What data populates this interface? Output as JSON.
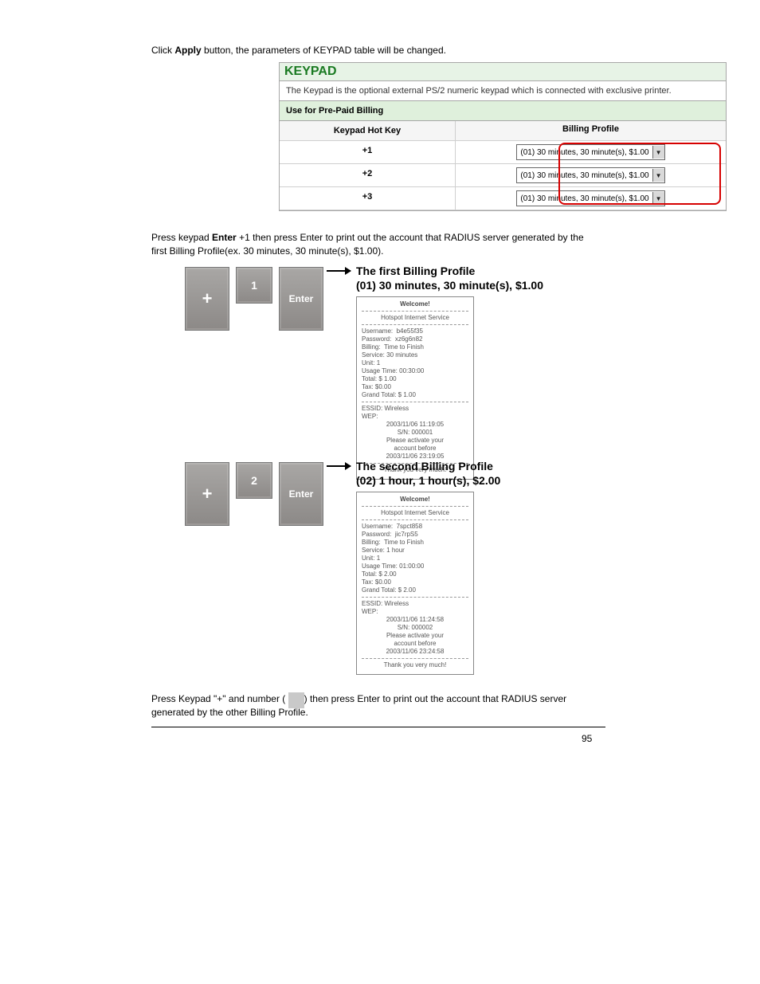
{
  "intro": {
    "prefix": "Click ",
    "apply": "Apply",
    "suffix": " button, the parameters of KEYPAD table will be changed."
  },
  "keypad_panel": {
    "title": "KEYPAD",
    "desc": "The Keypad is the optional external PS/2 numeric keypad which is connected with exclusive printer.",
    "section": "Use for Pre-Paid Billing",
    "col_hotkey": "Keypad Hot Key",
    "col_profile": "Billing Profile",
    "rows": [
      {
        "hotkey": "+1",
        "profile": "(01) 30 minutes, 30 minute(s), $1.00"
      },
      {
        "hotkey": "+2",
        "profile": "(01) 30 minutes, 30 minute(s), $1.00"
      },
      {
        "hotkey": "+3",
        "profile": "(01) 30 minutes, 30 minute(s), $1.00"
      }
    ]
  },
  "example": {
    "prefix": "Press keypad ",
    "plus": "+",
    "one": "1",
    "two": "2",
    "enter_word": "Enter",
    "suffix_1": " +1 then press Enter to print out the account that RADIUS server generated by the first Billing Profile(ex. 30 minutes, 30 minute(s), $1.00)."
  },
  "profile1": {
    "title_line1": "The first Billing Profile",
    "title_line2": "(01) 30 minutes, 30 minute(s), $1.00"
  },
  "profile2": {
    "title_line1": "The second Billing Profile",
    "title_line2": "(02) 1 hour, 1 hour(s), $2.00"
  },
  "receipt1": {
    "welcome": "Welcome!",
    "svc": "Hotspot Internet Service",
    "l_user": "Username:",
    "v_user": "b4e55f35",
    "l_pass": "Password:",
    "v_pass": "xz6g6n82",
    "l_bill": "Billing:",
    "v_bill": "Time to Finish",
    "l_svc": "Service:",
    "v_svc": "30 minutes",
    "l_unit": "Unit:",
    "v_unit": "1",
    "l_usage": "Usage Time:",
    "v_usage": "00:30:00",
    "l_total": "Total:",
    "v_total": "$ 1.00",
    "l_tax": "Tax:",
    "v_tax": "$0.00",
    "l_gtotal": "Grand Total:",
    "v_gtotal": "$ 1.00",
    "essid": "ESSID: Wireless",
    "wep": "WEP:",
    "ts": "2003/11/06 11:19:05",
    "sn": "S/N: 000001",
    "act1": "Please activate your",
    "act2": "account before",
    "exp": "2003/11/06 23:19:05",
    "thanks": "Thank you very much!"
  },
  "receipt2": {
    "welcome": "Welcome!",
    "svc": "Hotspot Internet Service",
    "l_user": "Username:",
    "v_user": "7spct858",
    "l_pass": "Password:",
    "v_pass": "jic7rpS5",
    "l_bill": "Billing:",
    "v_bill": "Time to Finish",
    "l_svc": "Service:",
    "v_svc": "1 hour",
    "l_unit": "Unit:",
    "v_unit": "1",
    "l_usage": "Usage Time:",
    "v_usage": "01:00:00",
    "l_total": "Total:",
    "v_total": "$ 2.00",
    "l_tax": "Tax:",
    "v_tax": "$0.00",
    "l_gtotal": "Grand Total:",
    "v_gtotal": "$ 2.00",
    "essid": "ESSID: Wireless",
    "wep": "WEP:",
    "ts": "2003/11/06 11:24:58",
    "sn": "S/N: 000002",
    "act1": "Please activate your",
    "act2": "account before",
    "exp": "2003/11/06 23:24:58",
    "thanks": "Thank you very much!"
  },
  "footer": {
    "prefix": "Press Keypad \"+\" and number (",
    "mid": ") then press Enter to print out the account that RADIUS server generated by the other Billing Profile.",
    "page": "95"
  }
}
